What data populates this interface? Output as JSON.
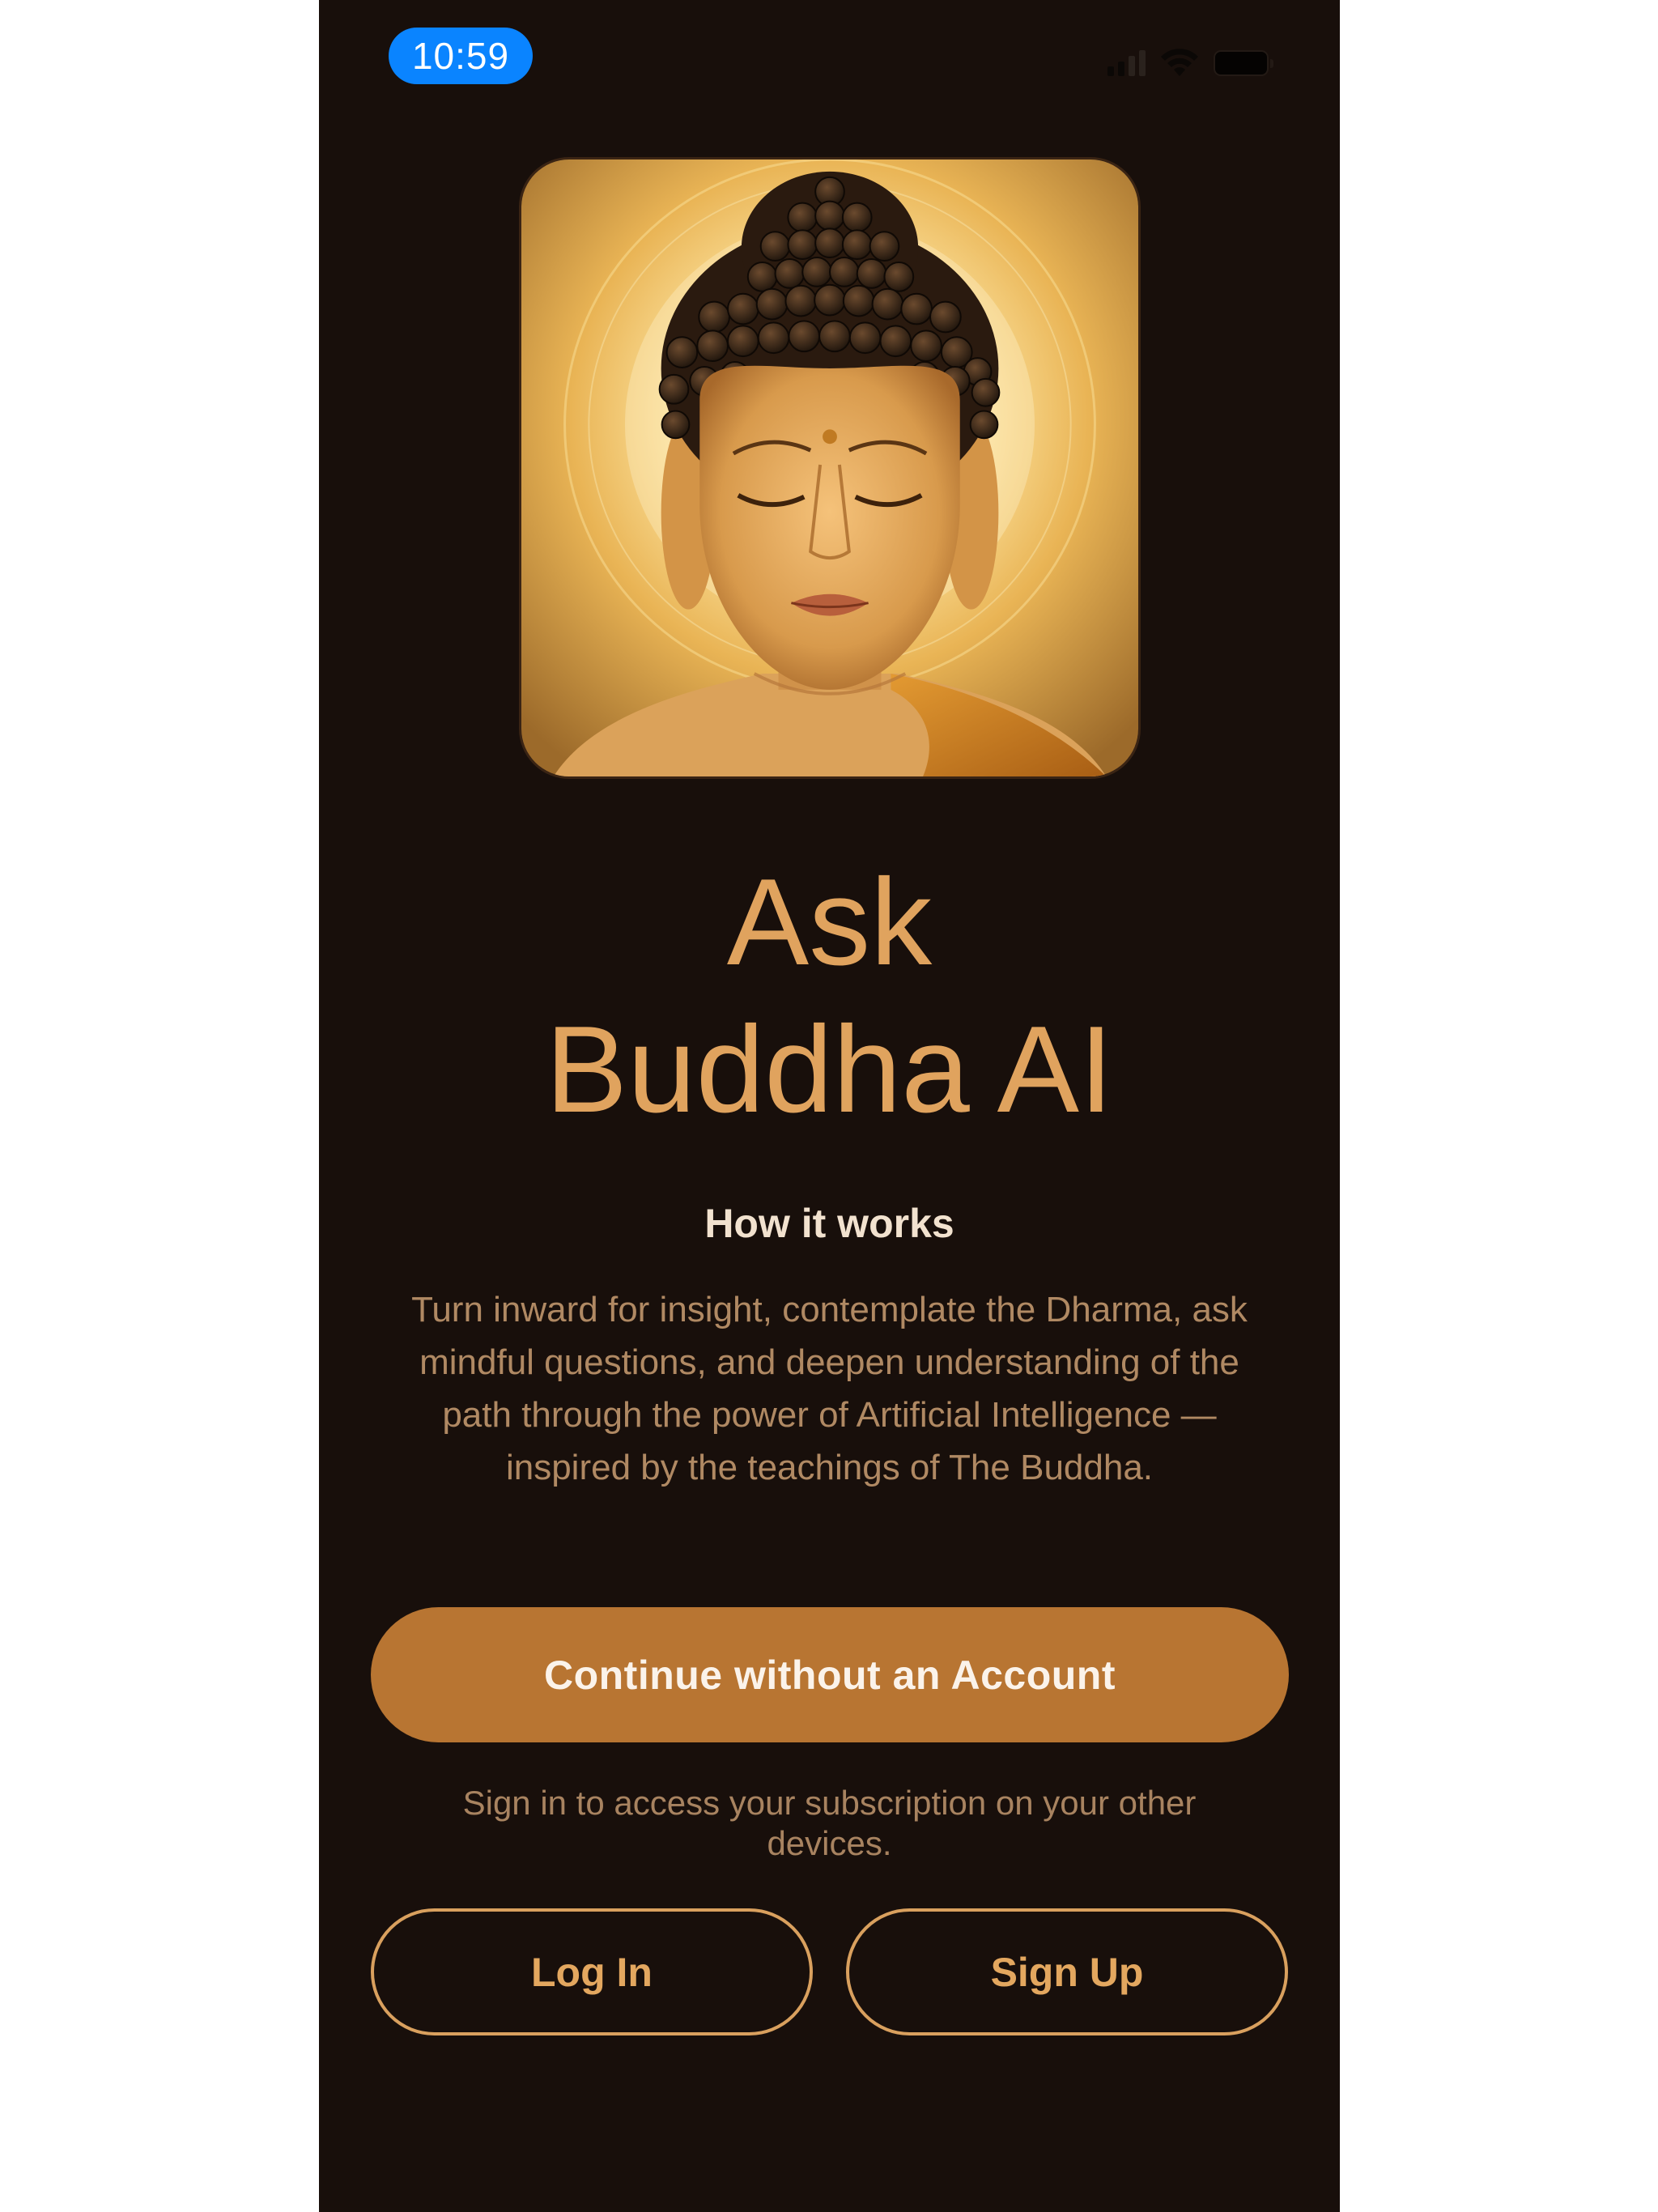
{
  "status_bar": {
    "time": "10:59",
    "icons": [
      "cellular-signal-icon",
      "wifi-icon",
      "battery-icon"
    ]
  },
  "hero": {
    "image": "buddha-portrait"
  },
  "title": {
    "line1": "Ask",
    "line2": "Buddha AI"
  },
  "how_it_works": {
    "heading": "How it works",
    "description": "Turn inward for insight, contemplate the Dharma, ask mindful questions, and deepen understanding of the path through the power of Artificial Intelligence — inspired by the teachings of The Buddha."
  },
  "actions": {
    "continue_label": "Continue without an Account",
    "signin_note": "Sign in to access your subscription on your other devices.",
    "login_label": "Log In",
    "signup_label": "Sign Up"
  },
  "colors": {
    "background": "#180f0b",
    "accent": "#b87532",
    "title": "#e0a35e",
    "time_pill": "#0a84ff"
  }
}
